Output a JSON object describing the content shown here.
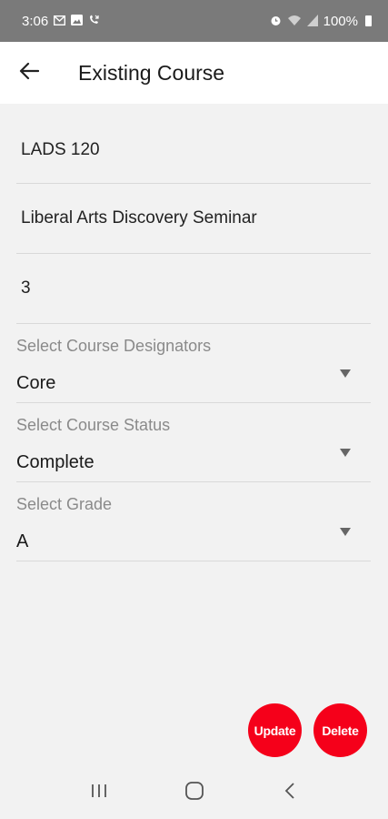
{
  "status_bar": {
    "time": "3:06",
    "battery": "100%",
    "left_icons": [
      "mail-icon",
      "gallery-icon",
      "missed-call-icon"
    ],
    "right_icons": [
      "alarm-icon",
      "wifi-icon",
      "signal-icon",
      "battery-icon"
    ]
  },
  "app_bar": {
    "title": "Existing Course",
    "back_icon": "arrow-left-icon"
  },
  "form": {
    "course_code": "LADS 120",
    "course_name": "Liberal Arts Discovery Seminar",
    "credits": "3",
    "designators": {
      "label": "Select Course Designators",
      "value": "Core"
    },
    "status": {
      "label": "Select Course Status",
      "value": "Complete"
    },
    "grade": {
      "label": "Select Grade",
      "value": "A"
    }
  },
  "actions": {
    "update_label": "Update",
    "delete_label": "Delete",
    "accent_color": "#f5001a"
  },
  "nav_bar": {
    "icons": [
      "recent-apps-icon",
      "home-icon",
      "back-icon"
    ]
  }
}
